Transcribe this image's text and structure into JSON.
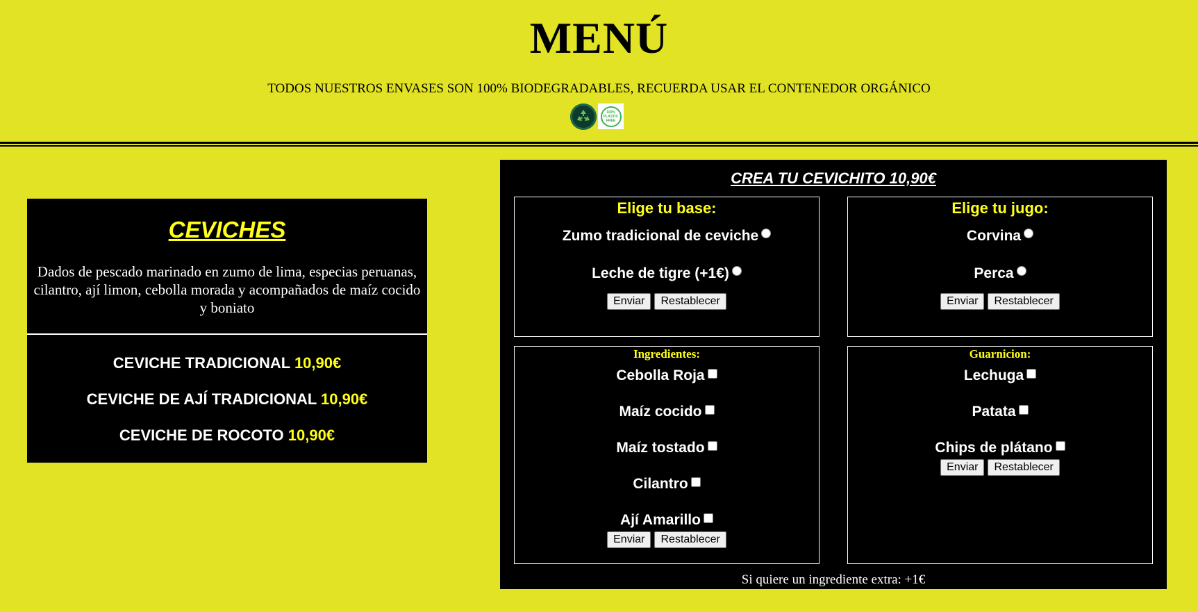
{
  "header": {
    "title": "MENÚ",
    "notice": "TODOS NUESTROS ENVASES SON 100% BIODEGRADABLES, RECUERDA USAR EL CONTENEDOR ORGÁNICO",
    "badge_plastic_text": "100% PLASTIC FREE"
  },
  "ceviches": {
    "title": "CEVICHES",
    "description": "Dados de pescado marinado en zumo de lima, especias peruanas, cilantro, ají limon, cebolla morada y acompañados de maíz cocido y boniato",
    "items": [
      {
        "name": "CEVICHE TRADICIONAL ",
        "price": "10,90€"
      },
      {
        "name": "CEVICHE DE AJÍ TRADICIONAL ",
        "price": "10,90€"
      },
      {
        "name": "CEVICHE DE ROCOTO ",
        "price": "10,90€"
      }
    ]
  },
  "builder": {
    "title": "CREA TU CEVICHITO 10,90€",
    "base": {
      "heading": "Elige tu base:",
      "options": [
        "Zumo tradicional de ceviche",
        "Leche de tigre (+1€)"
      ]
    },
    "jugo": {
      "heading": "Elige tu jugo:",
      "options": [
        "Corvina",
        "Perca"
      ]
    },
    "ingredientes": {
      "heading": "Ingredientes:",
      "options": [
        "Cebolla Roja",
        "Maíz cocido",
        "Maíz tostado",
        "Cilantro",
        "Ají Amarillo"
      ]
    },
    "guarnicion": {
      "heading": "Guarnicion:",
      "options": [
        "Lechuga",
        "Patata",
        "Chips de plátano"
      ]
    },
    "submit_label": "Enviar",
    "reset_label": "Restablecer",
    "extra_note": "Si quiere un ingrediente extra: +1€"
  },
  "colors": {
    "background": "#e1e324",
    "accent": "#ffff1a",
    "card": "#000000"
  }
}
